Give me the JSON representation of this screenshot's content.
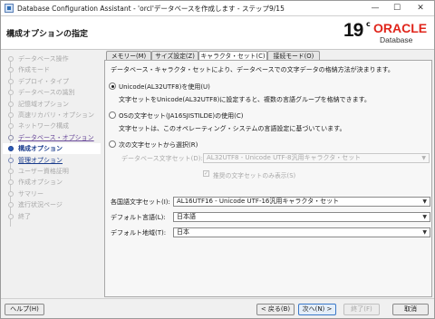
{
  "window": {
    "title": "Database Configuration Assistant - 'orcl'データベースを作成します - ステップ9/15",
    "controls": {
      "minimize": "—",
      "maximize": "☐",
      "close": "✕"
    }
  },
  "header": {
    "heading": "構成オプションの指定",
    "logo": {
      "version": "19",
      "version_suffix": "c",
      "brand": "ORACLE",
      "product": "Database"
    }
  },
  "nav": {
    "items": [
      {
        "label": "データベース操作",
        "state": "disabled"
      },
      {
        "label": "作成モード",
        "state": "disabled"
      },
      {
        "label": "デプロイ・タイプ",
        "state": "disabled"
      },
      {
        "label": "データベースの識別",
        "state": "disabled"
      },
      {
        "label": "記憶域オプション",
        "state": "disabled"
      },
      {
        "label": "高速リカバリ・オプション",
        "state": "disabled"
      },
      {
        "label": "ネットワーク構成",
        "state": "disabled"
      },
      {
        "label": "データベース・オプション",
        "state": "done"
      },
      {
        "label": "構成オプション",
        "state": "active"
      },
      {
        "label": "管理オプション",
        "state": "link"
      },
      {
        "label": "ユーザー資格証明",
        "state": "disabled"
      },
      {
        "label": "作成オプション",
        "state": "disabled"
      },
      {
        "label": "サマリー",
        "state": "disabled"
      },
      {
        "label": "進行状況ページ",
        "state": "disabled"
      },
      {
        "label": "終了",
        "state": "disabled"
      }
    ]
  },
  "tabs": [
    {
      "label": "メモリー(M)"
    },
    {
      "label": "サイズ設定(Z)"
    },
    {
      "label": "キャラクタ・セット(C)"
    },
    {
      "label": "接続モード(O)"
    }
  ],
  "charset": {
    "description": "データベース・キャラクタ・セットにより、データベースでの文字データの格納方法が決まります。",
    "option1": {
      "label": "Unicode(AL32UTF8)を使用(U)",
      "note": "文字セットをUnicode(AL32UTF8)に設定すると、複数の言語グループを格納できます。",
      "selected": true
    },
    "option2": {
      "label": "OSの文字セット(JA16SJISTILDE)の使用(C)",
      "note": "文字セットは、このオペレーティング・システムの言語設定に基づいています。",
      "selected": false
    },
    "option3": {
      "label": "次の文字セットから選択(R)",
      "selected": false
    },
    "db_charset_label": "データベース文字セット(D):",
    "db_charset_value": "AL32UTF8 - Unicode UTF-8汎用キャラクタ・セット",
    "recommended_label": "推奨の文字セットのみ表示(S)",
    "recommended_checked": true
  },
  "fields": {
    "national_label": "各国語文字セット(I):",
    "national_value": "AL16UTF16 - Unicode UTF-16汎用キャラクタ・セット",
    "language_label": "デフォルト言語(L):",
    "language_value": "日本語",
    "territory_label": "デフォルト地域(T):",
    "territory_value": "日本"
  },
  "footer": {
    "help": "ヘルプ(H)",
    "back": "< 戻る(B)",
    "next": "次へ(N) >",
    "finish": "終了(F)",
    "cancel": "取消"
  },
  "colors": {
    "oracle_red": "#e0251b",
    "link": "#1a3c8c",
    "visited": "#6a4a9a",
    "accent": "#3a78c8"
  }
}
